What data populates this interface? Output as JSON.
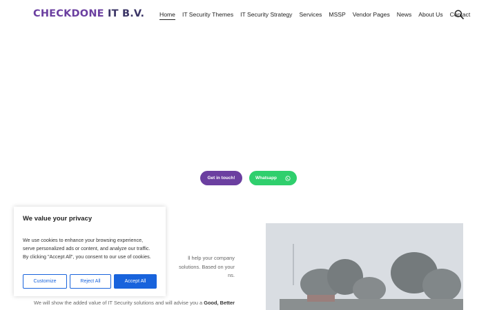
{
  "header": {
    "logo_part1": "CHECKDONE",
    "logo_part2": " IT B.V.",
    "nav": [
      "Home",
      "IT Security Themes",
      "IT Security Strategy",
      "Services",
      "MSSP",
      "Vendor Pages",
      "News",
      "About Us",
      "Contact"
    ],
    "search_icon": "search-icon"
  },
  "hero": {
    "get_in_touch": "Get in touch!",
    "whatsapp": "Whatsapp",
    "whatsapp_icon": "whatsapp-icon"
  },
  "content": {
    "para1_line1": "ll help your company",
    "para1_line2": "solutions. Based on your",
    "para1_line3": "ns.",
    "para2_text": "We will show the added value of IT Security solutions and will advise you a ",
    "para2_bold": "Good, Better"
  },
  "cookie": {
    "title": "We value your privacy",
    "line1": "We use cookies to enhance your browsing experience,",
    "line2": "serve personalized ads or content, and analyze our traffic.",
    "line3": "By clicking \"Accept All\", you consent to our use of cookies.",
    "customize": "Customize",
    "reject": "Reject All",
    "accept": "Accept All"
  },
  "colors": {
    "brand_purple": "#6b3fa0",
    "whatsapp_green": "#2fcf6d",
    "cookie_blue": "#1863dc"
  }
}
